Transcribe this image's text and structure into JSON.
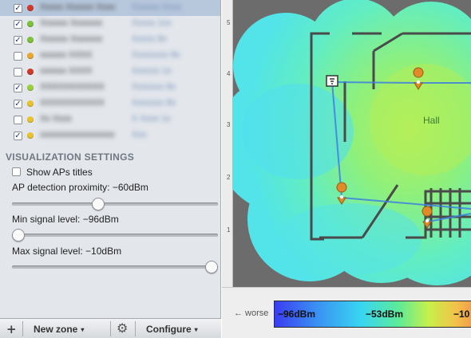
{
  "ap_list": [
    {
      "checked": true,
      "status_color": "#d13a2a",
      "name": "Xxxxx Xxxxxx Xxxx",
      "meta": "Xxxxxx Xxxx",
      "selected": true
    },
    {
      "checked": true,
      "status_color": "#7cc23a",
      "name": "Xxxxxx Xxxxxxx",
      "meta": "Xxxxx 1xx",
      "selected": false
    },
    {
      "checked": true,
      "status_color": "#7cc23a",
      "name": "Xxxxxx Xxxxxxx",
      "meta": "Xxxxx 8x",
      "selected": false
    },
    {
      "checked": false,
      "status_color": "#e9a92b",
      "name": "xxxxxx XXXX",
      "meta": "Xxxxxxxx 8x",
      "selected": false
    },
    {
      "checked": false,
      "status_color": "#d13a2a",
      "name": "xxxxxx XXXX",
      "meta": "Xxxxxx 1x",
      "selected": false
    },
    {
      "checked": true,
      "status_color": "#9bd23a",
      "name": "XXXXXXXXXXX",
      "meta": "Xxxxxxx 8x",
      "selected": false
    },
    {
      "checked": true,
      "status_color": "#e9c32b",
      "name": "XXXXXXXXXXX",
      "meta": "Xxxxxxx 8x",
      "selected": false
    },
    {
      "checked": false,
      "status_color": "#e9c32b",
      "name": "Xx Xxxx",
      "meta": "X Xxxx 1x",
      "selected": false
    },
    {
      "checked": true,
      "status_color": "#e9c32b",
      "name": "xxxxxxxxxxxxxxxxx",
      "meta": "Xxx",
      "selected": false
    }
  ],
  "visualization": {
    "title": "VISUALIZATION SETTINGS",
    "show_ap_titles": {
      "label": "Show APs titles",
      "checked": false
    },
    "ap_detection": {
      "label": "AP detection proximity: −60dBm",
      "level": 0.42
    },
    "min_signal": {
      "label": "Min signal level: −96dBm",
      "level": 0.03
    },
    "max_signal": {
      "label": "Max signal level: −10dBm",
      "level": 0.97
    }
  },
  "toolbar": {
    "add_icon": "+",
    "new_zone_label": "New zone",
    "gear_icon": "⚙",
    "configure_label": "Configure",
    "caret": "▾"
  },
  "map": {
    "room_label": "Hall",
    "ruler_marks": [
      "5",
      "4",
      "3",
      "2",
      "1"
    ]
  },
  "legend": {
    "worse_label": "← worse",
    "min_label": "−96dBm",
    "mid_label": "−53dBm",
    "max_label": "−10"
  }
}
